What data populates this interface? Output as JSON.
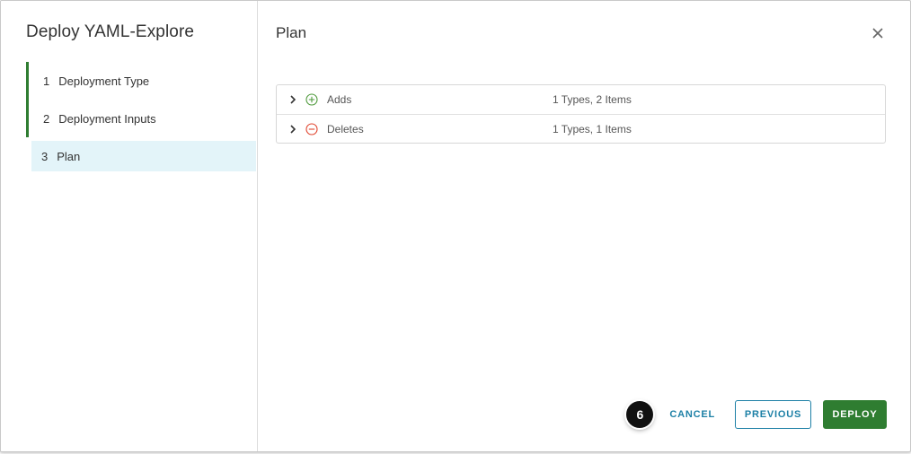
{
  "wizard": {
    "title": "Deploy YAML-Explore",
    "steps": [
      {
        "number": "1",
        "label": "Deployment Type",
        "state": "completed"
      },
      {
        "number": "2",
        "label": "Deployment Inputs",
        "state": "completed"
      },
      {
        "number": "3",
        "label": "Plan",
        "state": "active"
      }
    ]
  },
  "page": {
    "title": "Plan",
    "close_icon": "close-icon"
  },
  "plan": {
    "rows": [
      {
        "name": "Adds",
        "summary": "1 Types, 2 Items",
        "icon": "plus-circle-icon",
        "icon_color": "#4f9a3c"
      },
      {
        "name": "Deletes",
        "summary": "1 Types, 1 Items",
        "icon": "minus-circle-icon",
        "icon_color": "#e0452f"
      }
    ]
  },
  "footer": {
    "marker": "6",
    "cancel_label": "CANCEL",
    "previous_label": "PREVIOUS",
    "deploy_label": "DEPLOY"
  },
  "colors": {
    "accent": "#1d80a6",
    "primary_button": "#2f7d31",
    "step_complete": "#2f7d31",
    "active_step_bg": "#e3f4f9"
  }
}
